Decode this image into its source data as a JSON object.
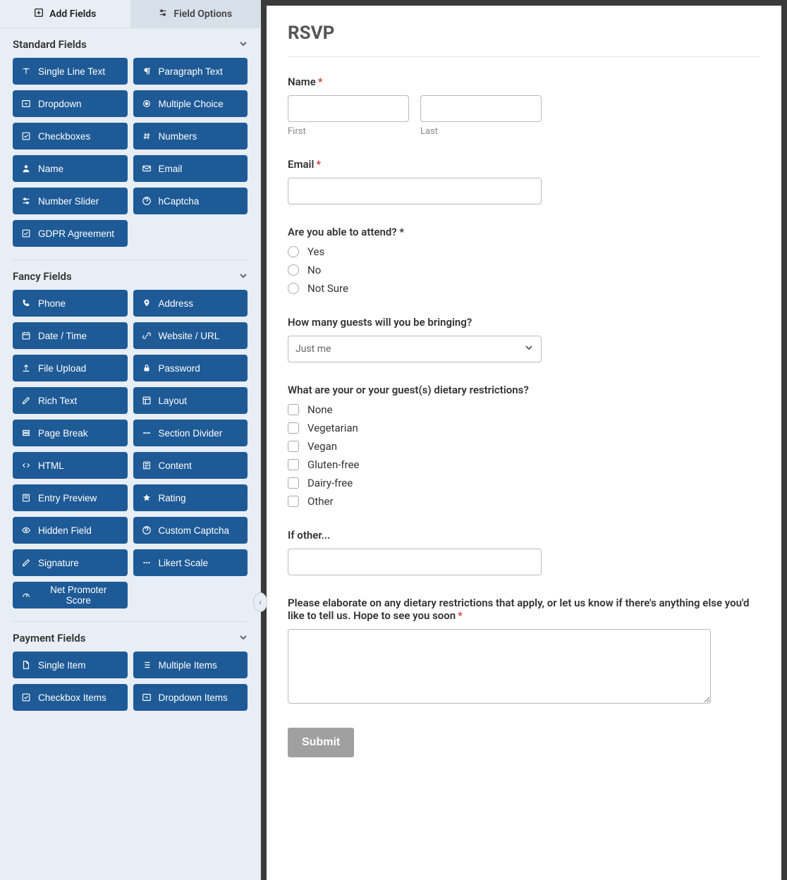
{
  "tabs": {
    "add_fields": "Add Fields",
    "field_options": "Field Options"
  },
  "sections": {
    "standard": {
      "title": "Standard Fields",
      "fields": [
        {
          "label": "Single Line Text",
          "icon": "text-icon"
        },
        {
          "label": "Paragraph Text",
          "icon": "paragraph-icon"
        },
        {
          "label": "Dropdown",
          "icon": "dropdown-icon"
        },
        {
          "label": "Multiple Choice",
          "icon": "radio-icon"
        },
        {
          "label": "Checkboxes",
          "icon": "checkbox-icon"
        },
        {
          "label": "Numbers",
          "icon": "hash-icon"
        },
        {
          "label": "Name",
          "icon": "user-icon"
        },
        {
          "label": "Email",
          "icon": "mail-icon"
        },
        {
          "label": "Number Slider",
          "icon": "slider-icon"
        },
        {
          "label": "hCaptcha",
          "icon": "help-icon"
        },
        {
          "label": "GDPR Agreement",
          "icon": "checkbox-icon"
        }
      ]
    },
    "fancy": {
      "title": "Fancy Fields",
      "fields": [
        {
          "label": "Phone",
          "icon": "phone-icon"
        },
        {
          "label": "Address",
          "icon": "pin-icon"
        },
        {
          "label": "Date / Time",
          "icon": "calendar-icon"
        },
        {
          "label": "Website / URL",
          "icon": "link-icon"
        },
        {
          "label": "File Upload",
          "icon": "upload-icon"
        },
        {
          "label": "Password",
          "icon": "lock-icon"
        },
        {
          "label": "Rich Text",
          "icon": "pencil-icon"
        },
        {
          "label": "Layout",
          "icon": "layout-icon"
        },
        {
          "label": "Page Break",
          "icon": "pagebreak-icon"
        },
        {
          "label": "Section Divider",
          "icon": "divider-icon"
        },
        {
          "label": "HTML",
          "icon": "code-icon"
        },
        {
          "label": "Content",
          "icon": "content-icon"
        },
        {
          "label": "Entry Preview",
          "icon": "preview-icon"
        },
        {
          "label": "Rating",
          "icon": "star-icon"
        },
        {
          "label": "Hidden Field",
          "icon": "eye-icon"
        },
        {
          "label": "Custom Captcha",
          "icon": "help-icon"
        },
        {
          "label": "Signature",
          "icon": "pencil-icon"
        },
        {
          "label": "Likert Scale",
          "icon": "dots-icon"
        },
        {
          "label": "Net Promoter Score",
          "icon": "gauge-icon"
        }
      ]
    },
    "payment": {
      "title": "Payment Fields",
      "fields": [
        {
          "label": "Single Item",
          "icon": "file-icon"
        },
        {
          "label": "Multiple Items",
          "icon": "list-icon"
        },
        {
          "label": "Checkbox Items",
          "icon": "checkbox-icon"
        },
        {
          "label": "Dropdown Items",
          "icon": "dropdown-icon"
        }
      ]
    }
  },
  "form": {
    "title": "RSVP",
    "name": {
      "label": "Name",
      "required": true,
      "first_sub": "First",
      "last_sub": "Last"
    },
    "email": {
      "label": "Email",
      "required": true
    },
    "attend": {
      "label": "Are you able to attend? *",
      "options": [
        "Yes",
        "No",
        "Not Sure"
      ]
    },
    "guests": {
      "label": "How many guests will you be bringing?",
      "selected": "Just me"
    },
    "dietary": {
      "label": "What are your or your guest(s) dietary restrictions?",
      "options": [
        "None",
        "Vegetarian",
        "Vegan",
        "Gluten-free",
        "Dairy-free",
        "Other"
      ]
    },
    "other": {
      "label": "If other..."
    },
    "elaborate": {
      "label": "Please elaborate on any dietary restrictions that apply, or let us know if there's anything else you'd like to tell us. Hope to see you soon",
      "required": true
    },
    "submit": "Submit"
  }
}
